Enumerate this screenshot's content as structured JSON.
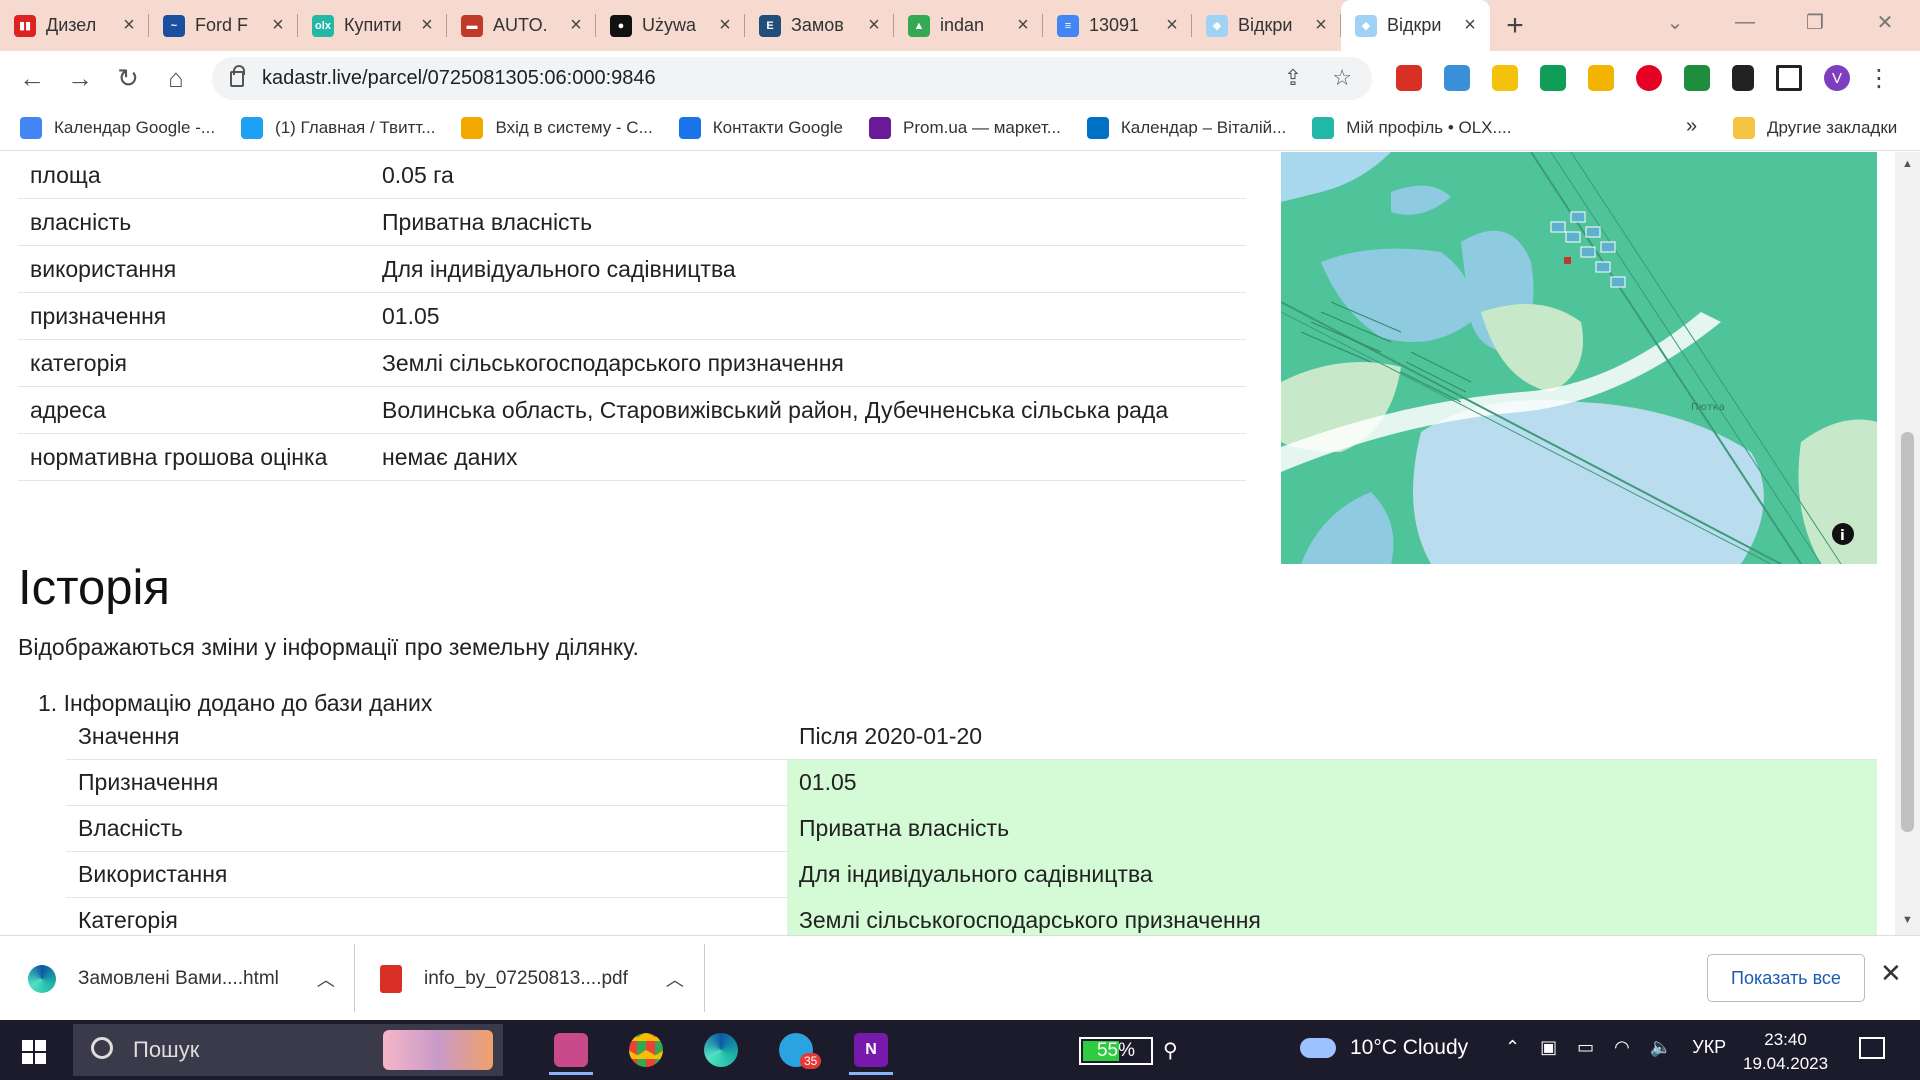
{
  "tabs": [
    {
      "title": "Дизел",
      "fav_color": "#d22",
      "fav_glyph": "▮▮"
    },
    {
      "title": "Ford F",
      "fav_color": "#1a4fa0",
      "fav_glyph": "~"
    },
    {
      "title": "Купити",
      "fav_color": "#23b7a8",
      "fav_glyph": "olx"
    },
    {
      "title": "AUTO.",
      "fav_color": "#c0392b",
      "fav_glyph": "▬"
    },
    {
      "title": "Używa",
      "fav_color": "#111",
      "fav_glyph": "●"
    },
    {
      "title": "Замов",
      "fav_color": "#1f4e79",
      "fav_glyph": "E"
    },
    {
      "title": "indan",
      "fav_color": "#34a853",
      "fav_glyph": "▲"
    },
    {
      "title": "13091",
      "fav_color": "#4285f4",
      "fav_glyph": "≡"
    },
    {
      "title": "Відкри",
      "fav_color": "#9fd2f5",
      "fav_glyph": "◆"
    },
    {
      "title": "Відкри",
      "fav_color": "#9fd2f5",
      "fav_glyph": "◆"
    }
  ],
  "url": "kadastr.live/parcel/0725081305:06:000:9846",
  "bookmarks": [
    {
      "label": "Календар Google -...",
      "color": "#4285f4"
    },
    {
      "label": "(1) Главная / Твитт...",
      "color": "#1da1f2"
    },
    {
      "label": "Вхід в систему - С...",
      "color": "#f2a900"
    },
    {
      "label": "Контакти Google",
      "color": "#1a73e8"
    },
    {
      "label": "Prom.ua — маркет...",
      "color": "#6a1b9a"
    },
    {
      "label": "Календар – Віталій...",
      "color": "#0072c6"
    },
    {
      "label": "Мій профіль • OLX....",
      "color": "#23b7a8"
    }
  ],
  "bookmarks_overflow": "»",
  "other_bookmarks": "Другие закладки",
  "parcel_info": [
    {
      "key": "площа",
      "value": "0.05 га"
    },
    {
      "key": "власність",
      "value": "Приватна власність"
    },
    {
      "key": "використання",
      "value": "Для індивідуального садівництва"
    },
    {
      "key": "призначення",
      "value": "01.05"
    },
    {
      "key": "категорія",
      "value": "Землі сільськогосподарського призначення"
    },
    {
      "key": "адреса",
      "value": "Волинська область, Старовижівський район, Дубечненська сільська рада"
    },
    {
      "key": "нормативна грошова оцінка",
      "value": "немає даних"
    }
  ],
  "map_label": "Пютка",
  "history": {
    "title": "Історія",
    "description": "Відображаються зміни у інформації про земельну ділянку.",
    "item_title": "1. Інформацію додано до бази даних",
    "rows": [
      {
        "key": "Значення",
        "value": "Після 2020-01-20",
        "highlight": false
      },
      {
        "key": "Призначення",
        "value": "01.05",
        "highlight": true
      },
      {
        "key": "Власність",
        "value": "Приватна власність",
        "highlight": true
      },
      {
        "key": "Використання",
        "value": "Для індивідуального садівництва",
        "highlight": true
      },
      {
        "key": "Категорія",
        "value": "Землі сільськогосподарського призначення",
        "highlight": true
      }
    ]
  },
  "downloads": {
    "items": [
      {
        "name": "Замовлені Вами....html",
        "icon": "edge-icon"
      },
      {
        "name": "info_by_07250813....pdf",
        "icon": "pdf-icon"
      }
    ],
    "show_all": "Показать все"
  },
  "taskbar": {
    "search_placeholder": "Пошук",
    "battery": "55%",
    "battery_level": 0.55,
    "weather": "10°C  Cloudy",
    "language": "УКР",
    "time": "23:40",
    "date": "19.04.2023",
    "telegram_badge": "35"
  },
  "colors": {
    "tabbar_bg": "#f6d9cf",
    "highlight": "#d4fbd6",
    "map_green": "#4fc49a",
    "map_water": "#a8d8ee"
  }
}
